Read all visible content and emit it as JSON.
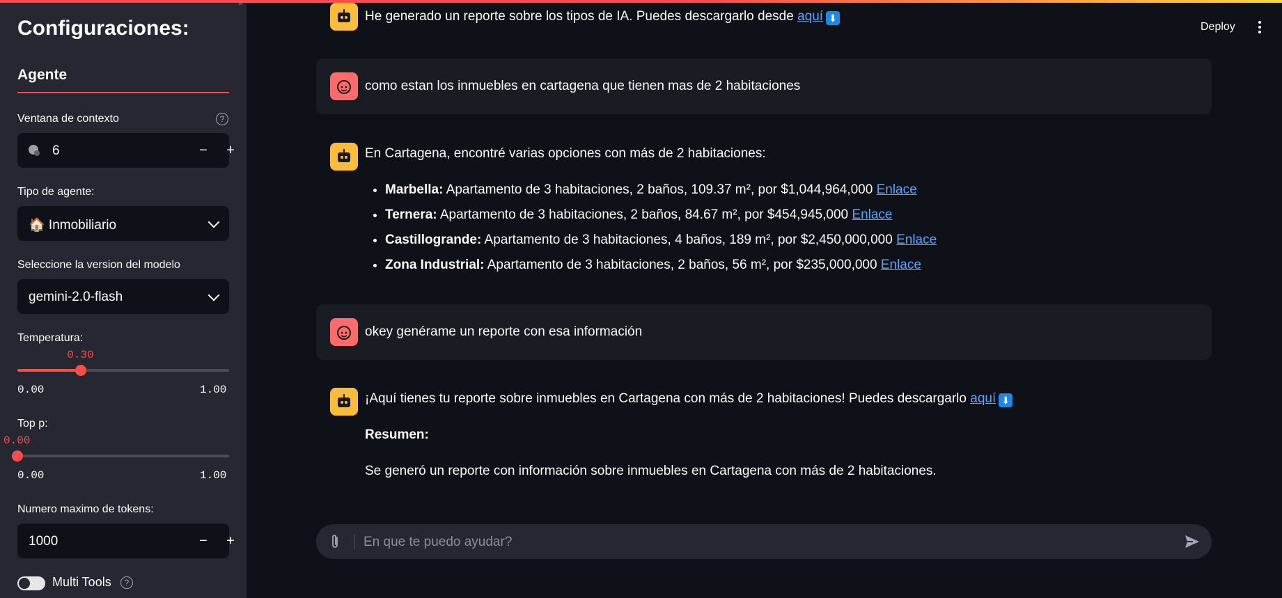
{
  "sidebar": {
    "title": "Configuraciones:",
    "tab": "Agente",
    "context_window": {
      "label": "Ventana de contexto",
      "value": "6",
      "minus": "−",
      "plus": "+"
    },
    "agent_type": {
      "label": "Tipo de agente:",
      "value": "🏠 Inmobiliario"
    },
    "model": {
      "label": "Seleccione la version del modelo",
      "value": "gemini-2.0-flash"
    },
    "temperature": {
      "label": "Temperatura:",
      "value": "0.30",
      "min": "0.00",
      "max": "1.00",
      "fraction": 0.3
    },
    "top_p": {
      "label": "Top p:",
      "value": "0.00",
      "min": "0.00",
      "max": "1.00",
      "fraction": 0.0
    },
    "max_tokens": {
      "label": "Numero maximo de tokens:",
      "value": "1000",
      "minus": "−",
      "plus": "+"
    },
    "multi_tools": {
      "label": "Multi Tools",
      "enabled": false
    }
  },
  "header": {
    "deploy": "Deploy"
  },
  "messages": {
    "m1": {
      "text": "He generado un reporte sobre los tipos de IA. Puedes descargarlo desde ",
      "link": "aquí"
    },
    "m2": {
      "text": "como estan los inmuebles en cartagena que tienen mas de 2 habitaciones"
    },
    "m3": {
      "intro": "En Cartagena, encontré varias opciones con más de 2 habitaciones:",
      "items": [
        {
          "name": "Marbella:",
          "desc": " Apartamento de 3 habitaciones, 2 baños, 109.37 m², por $1,044,964,000 ",
          "link": "Enlace"
        },
        {
          "name": "Ternera:",
          "desc": " Apartamento de 3 habitaciones, 2 baños, 84.67 m², por $454,945,000 ",
          "link": "Enlace"
        },
        {
          "name": "Castillogrande:",
          "desc": " Apartamento de 3 habitaciones, 4 baños, 189 m², por $2,450,000,000 ",
          "link": "Enlace"
        },
        {
          "name": "Zona Industrial:",
          "desc": " Apartamento de 3 habitaciones, 2 baños, 56 m², por $235,000,000 ",
          "link": "Enlace"
        }
      ]
    },
    "m4": {
      "text": "okey genérame un reporte con esa información"
    },
    "m5": {
      "text": "¡Aquí tienes tu reporte sobre inmuebles en Cartagena con más de 2 habitaciones! Puedes descargarlo ",
      "link": "aquí",
      "summary_title": "Resumen:",
      "summary": "Se generó un reporte con información sobre inmuebles en Cartagena con más de 2 habitaciones."
    }
  },
  "chat_input": {
    "placeholder": "En que te puedo ayudar?",
    "value": ""
  },
  "icons": {
    "bot": "robot-face-icon",
    "user": "user-face-icon",
    "download": "down-arrow-icon",
    "clip": "paperclip-icon",
    "send": "send-icon",
    "kebab": "kebab-menu-icon",
    "brain": "brain-gear-icon"
  }
}
